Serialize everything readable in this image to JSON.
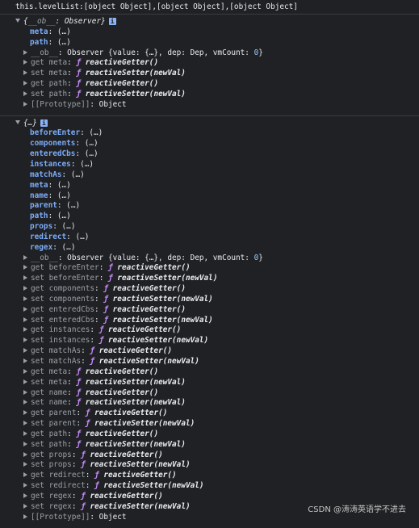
{
  "log_line": "this.levelList:[object Object],[object Object],[object Object]",
  "object1": {
    "header_prefix": "{",
    "header_ob": "__ob__",
    "header_sep": ": ",
    "header_type": "Observer",
    "header_suffix": "}",
    "info": "i",
    "props": [
      {
        "key": "meta",
        "value": "(…)"
      },
      {
        "key": "path",
        "value": "(…)"
      }
    ],
    "ob_key": "__ob__",
    "ob_value_prefix": "Observer {value: {…}, dep: Dep, vmCount: ",
    "ob_vmcount": "0",
    "ob_value_suffix": "}",
    "accessors": [
      {
        "kind": "get",
        "name": "meta",
        "fn": "reactiveGetter()"
      },
      {
        "kind": "set",
        "name": "meta",
        "fn": "reactiveSetter(newVal)"
      },
      {
        "kind": "get",
        "name": "path",
        "fn": "reactiveGetter()"
      },
      {
        "kind": "set",
        "name": "path",
        "fn": "reactiveSetter(newVal)"
      }
    ],
    "prototype_key": "[[Prototype]]",
    "prototype_value": "Object"
  },
  "object2": {
    "header": "{…}",
    "info": "i",
    "props": [
      {
        "key": "beforeEnter",
        "value": "(…)"
      },
      {
        "key": "components",
        "value": "(…)"
      },
      {
        "key": "enteredCbs",
        "value": "(…)"
      },
      {
        "key": "instances",
        "value": "(…)"
      },
      {
        "key": "matchAs",
        "value": "(…)"
      },
      {
        "key": "meta",
        "value": "(…)"
      },
      {
        "key": "name",
        "value": "(…)"
      },
      {
        "key": "parent",
        "value": "(…)"
      },
      {
        "key": "path",
        "value": "(…)"
      },
      {
        "key": "props",
        "value": "(…)"
      },
      {
        "key": "redirect",
        "value": "(…)"
      },
      {
        "key": "regex",
        "value": "(…)"
      }
    ],
    "ob_key": "__ob__",
    "ob_value_prefix": "Observer {value: {…}, dep: Dep, vmCount: ",
    "ob_vmcount": "0",
    "ob_value_suffix": "}",
    "accessors": [
      {
        "kind": "get",
        "name": "beforeEnter",
        "fn": "reactiveGetter()"
      },
      {
        "kind": "set",
        "name": "beforeEnter",
        "fn": "reactiveSetter(newVal)"
      },
      {
        "kind": "get",
        "name": "components",
        "fn": "reactiveGetter()"
      },
      {
        "kind": "set",
        "name": "components",
        "fn": "reactiveSetter(newVal)"
      },
      {
        "kind": "get",
        "name": "enteredCbs",
        "fn": "reactiveGetter()"
      },
      {
        "kind": "set",
        "name": "enteredCbs",
        "fn": "reactiveSetter(newVal)"
      },
      {
        "kind": "get",
        "name": "instances",
        "fn": "reactiveGetter()"
      },
      {
        "kind": "set",
        "name": "instances",
        "fn": "reactiveSetter(newVal)"
      },
      {
        "kind": "get",
        "name": "matchAs",
        "fn": "reactiveGetter()"
      },
      {
        "kind": "set",
        "name": "matchAs",
        "fn": "reactiveSetter(newVal)"
      },
      {
        "kind": "get",
        "name": "meta",
        "fn": "reactiveGetter()"
      },
      {
        "kind": "set",
        "name": "meta",
        "fn": "reactiveSetter(newVal)"
      },
      {
        "kind": "get",
        "name": "name",
        "fn": "reactiveGetter()"
      },
      {
        "kind": "set",
        "name": "name",
        "fn": "reactiveSetter(newVal)"
      },
      {
        "kind": "get",
        "name": "parent",
        "fn": "reactiveGetter()"
      },
      {
        "kind": "set",
        "name": "parent",
        "fn": "reactiveSetter(newVal)"
      },
      {
        "kind": "get",
        "name": "path",
        "fn": "reactiveGetter()"
      },
      {
        "kind": "set",
        "name": "path",
        "fn": "reactiveSetter(newVal)"
      },
      {
        "kind": "get",
        "name": "props",
        "fn": "reactiveGetter()"
      },
      {
        "kind": "set",
        "name": "props",
        "fn": "reactiveSetter(newVal)"
      },
      {
        "kind": "get",
        "name": "redirect",
        "fn": "reactiveGetter()"
      },
      {
        "kind": "set",
        "name": "redirect",
        "fn": "reactiveSetter(newVal)"
      },
      {
        "kind": "get",
        "name": "regex",
        "fn": "reactiveGetter()"
      },
      {
        "kind": "set",
        "name": "regex",
        "fn": "reactiveSetter(newVal)"
      }
    ],
    "prototype_key": "[[Prototype]]",
    "prototype_value": "Object"
  },
  "colon": ": ",
  "fn_symbol": "ƒ",
  "watermark": "CSDN @涛涛英语学不进去"
}
